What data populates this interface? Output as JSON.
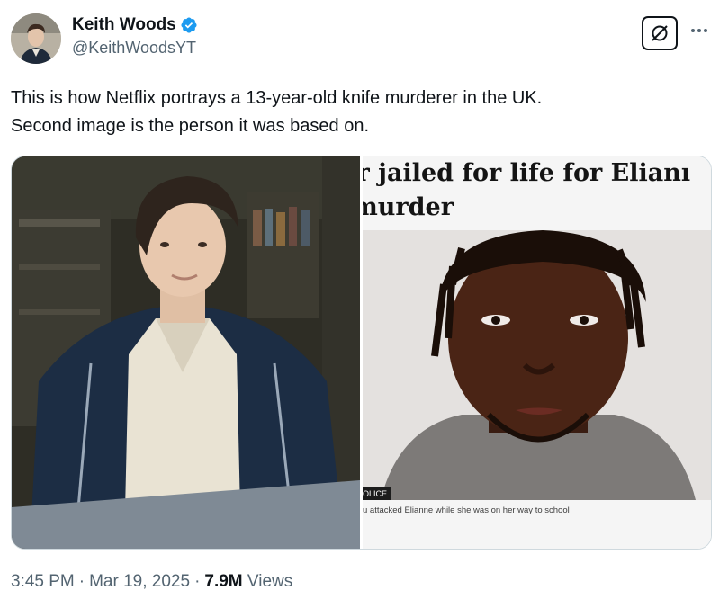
{
  "author": {
    "name": "Keith Woods",
    "handle": "@KeithWoodsYT",
    "verified": true,
    "verified_color": "#1d9bf0"
  },
  "header": {
    "grok_icon": "grok-icon",
    "more_icon": "more-dots-icon"
  },
  "tweet": {
    "line1": "This is how Netflix portrays a 13-year-old knife murderer in the UK.",
    "line2": "Second image is the person it was based on."
  },
  "media": {
    "right": {
      "headline_line1": "ager jailed for life for Elianı",
      "headline_line2": "ım murder",
      "photo_label": "OLICE",
      "caption": "u attacked Elianne while she was on her way to school"
    }
  },
  "meta": {
    "time": "3:45 PM",
    "sep1": "·",
    "date": "Mar 19, 2025",
    "sep2": "·",
    "views_count": "7.9M",
    "views_label": "Views"
  },
  "colors": {
    "text_primary": "#0f1419",
    "text_secondary": "#536471",
    "border": "#cfd9de"
  }
}
